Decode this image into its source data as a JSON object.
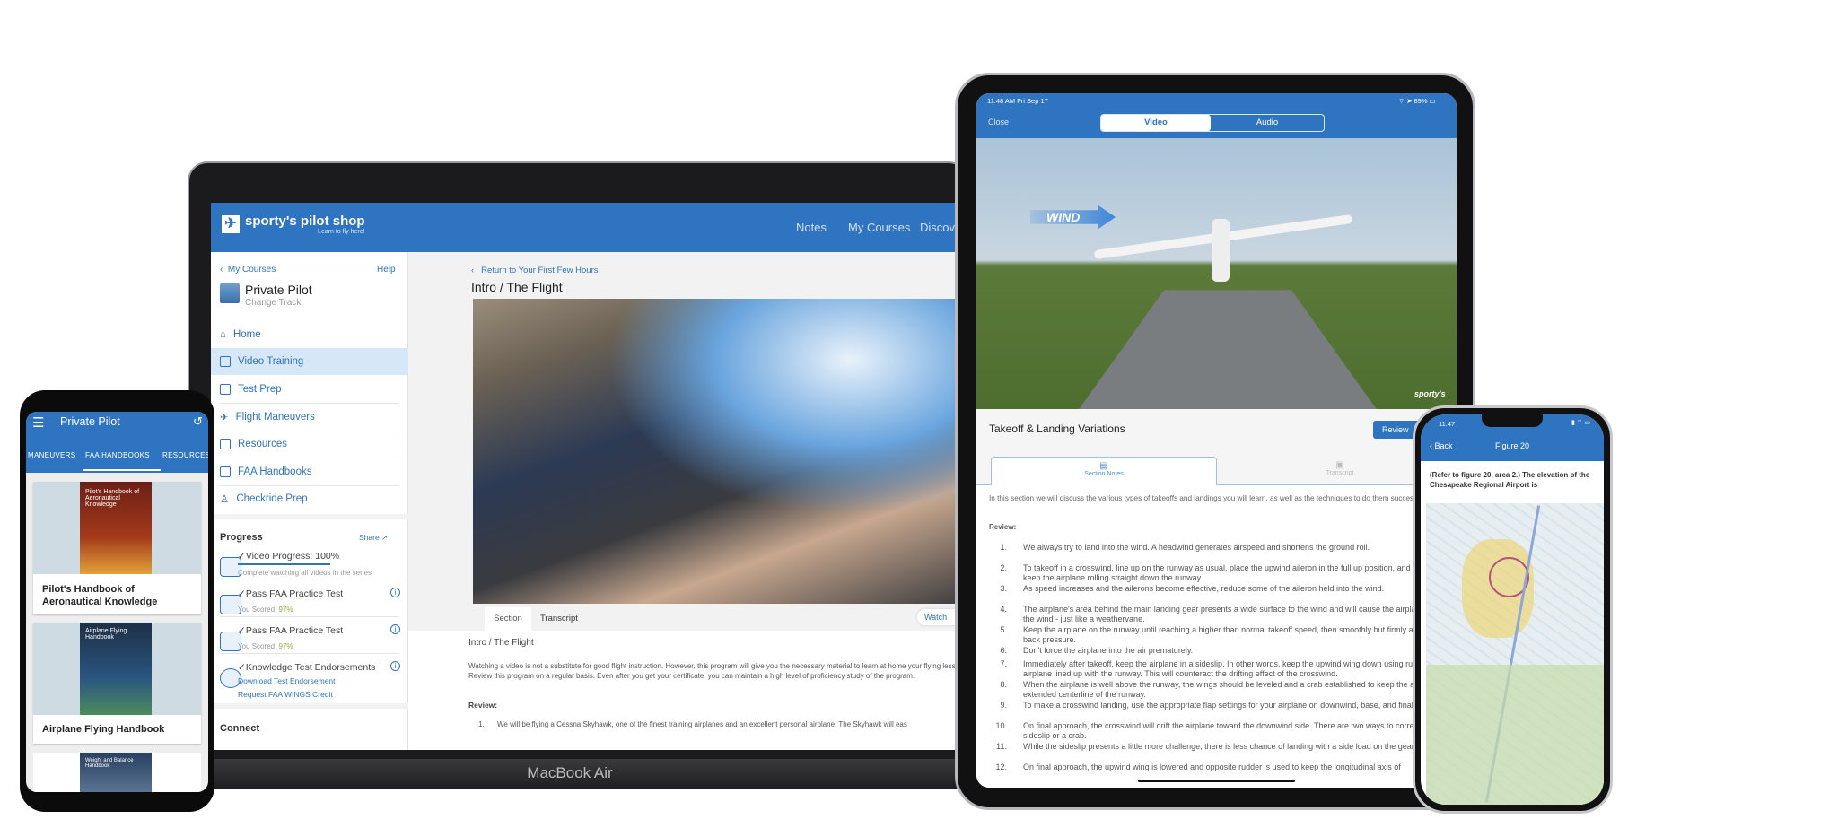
{
  "laptop": {
    "device_label": "MacBook Air",
    "brand": "sporty's pilot shop",
    "brand_tagline": "Learn to fly here!",
    "nav": [
      "Notes",
      "My Courses",
      "Discover"
    ],
    "sidebar": {
      "back_label": "My Courses",
      "help_label": "Help",
      "course_title": "Private Pilot",
      "change_track": "Change Track",
      "items": [
        {
          "label": "Home",
          "icon": "home-icon"
        },
        {
          "label": "Video Training",
          "icon": "video-icon",
          "active": true
        },
        {
          "label": "Test Prep",
          "icon": "document-icon"
        },
        {
          "label": "Flight Maneuvers",
          "icon": "airplane-icon"
        },
        {
          "label": "Resources",
          "icon": "pdf-icon"
        },
        {
          "label": "FAA Handbooks",
          "icon": "pdf-icon"
        },
        {
          "label": "Checkride Prep",
          "icon": "examiner-icon"
        }
      ],
      "progress": {
        "heading": "Progress",
        "share_label": "Share",
        "video": {
          "title": "Video Progress: 100%",
          "percent": 100,
          "note": "Complete watching all videos in the series"
        },
        "test1": {
          "title": "Pass FAA Practice Test",
          "score_label": "You Scored:",
          "score": "97%"
        },
        "test2": {
          "title": "Pass FAA Practice Test",
          "score_label": "You Scored:",
          "score": "97%"
        },
        "endorse": {
          "title": "Knowledge Test Endorsements",
          "link1": "Download Test Endorsement",
          "link2": "Request FAA WINGS Credit"
        }
      },
      "connect_heading": "Connect"
    },
    "main": {
      "back_link": "Return to Your First Few Hours",
      "title": "Intro / The Flight",
      "tabs": [
        "Section Notes",
        "Transcript"
      ],
      "watch_button": "Watch",
      "notes_title": "Intro / The Flight",
      "notes_para": "Watching a video is not a substitute for good flight instruction. However, this program will give you the necessary material to learn at home your flying lessons. Review this program on a regular basis. Even after you get your certificate, you can maintain a high level of proficiency study of the program.",
      "review_label": "Review:",
      "review_items": [
        "We will be flying a Cessna Skyhawk, one of the finest training airplanes and an excellent personal airplane. The Skyhawk will eas"
      ]
    }
  },
  "ipad": {
    "status_time": "11:48 AM  Fri Sep 17",
    "battery": "89%",
    "close_label": "Close",
    "segments": [
      "Video",
      "Audio"
    ],
    "video_overlay": "WIND",
    "watermark": "sporty's",
    "title": "Takeoff & Landing Variations",
    "review_button": "Review",
    "tabs": [
      "Section Notes",
      "Transcript"
    ],
    "intro": "In this section we will discuss the various types of takeoffs and landings you will learn, as well as the techniques to do them successfully.",
    "review_label": "Review:",
    "items": [
      "We always try to land into the wind. A headwind generates airspeed and shortens the ground roll.",
      "To takeoff in a crosswind, line up on the runway as usual, place the upwind aileron in the full up position, and use rudder to keep the airplane rolling straight down the runway.",
      "As speed increases and the ailerons become effective, reduce some of the aileron held into the wind.",
      "The airplane's area behind the main landing gear presents a wide surface to the wind and will cause the airplane to turn into the wind - just like a weathervane.",
      "Keep the airplane on the runway until reaching a higher than normal takeoff speed, then smoothly but firmly apply elevator back pressure.",
      "Don't force the airplane into the air prematurely.",
      "Immediately after takeoff, keep the airplane in a sideslip. In other words, keep the upwind wing down using rudder to keep the airplane lined up with the runway. This will counteract the drifting effect of the crosswind.",
      "When the airplane is well above the runway, the wings should be leveled and a crab established to keep the airplane on the extended centerline of the runway.",
      "To make a crosswind landing, use the appropriate flap settings for your airplane on downwind, base, and final.",
      "On final approach, the crosswind will drift the airplane toward the downwind side. There are two ways to correct this drift - a sideslip or a crab.",
      "While the sideslip presents a little more challenge, there is less chance of landing with a side load on the gear.",
      "On final approach, the upwind wing is lowered and opposite rudder is used to keep the longitudinal axis of"
    ]
  },
  "iphone": {
    "status_time": "11:47",
    "back_label": "Back",
    "title": "Figure 20",
    "question": "(Refer to figure 20, area 2.) The elevation of the Chesapeake Regional Airport is"
  },
  "android": {
    "title": "Private Pilot",
    "tabs": [
      "MANEUVERS",
      "FAA HANDBOOKS",
      "RESOURCES"
    ],
    "active_tab": "FAA HANDBOOKS",
    "cards": [
      {
        "title": "Pilot's Handbook of Aeronautical Knowledge",
        "cover": "Pilot's Handbook of Aeronautical Knowledge"
      },
      {
        "title": "Airplane Flying Handbook",
        "cover": "Airplane Flying Handbook"
      },
      {
        "title": "",
        "cover": "Weight and Balance Handbook"
      }
    ]
  },
  "colors": {
    "brand_blue": "#2f74c0",
    "active_bg": "#d6e7f7",
    "score_green": "#8bb33a"
  }
}
